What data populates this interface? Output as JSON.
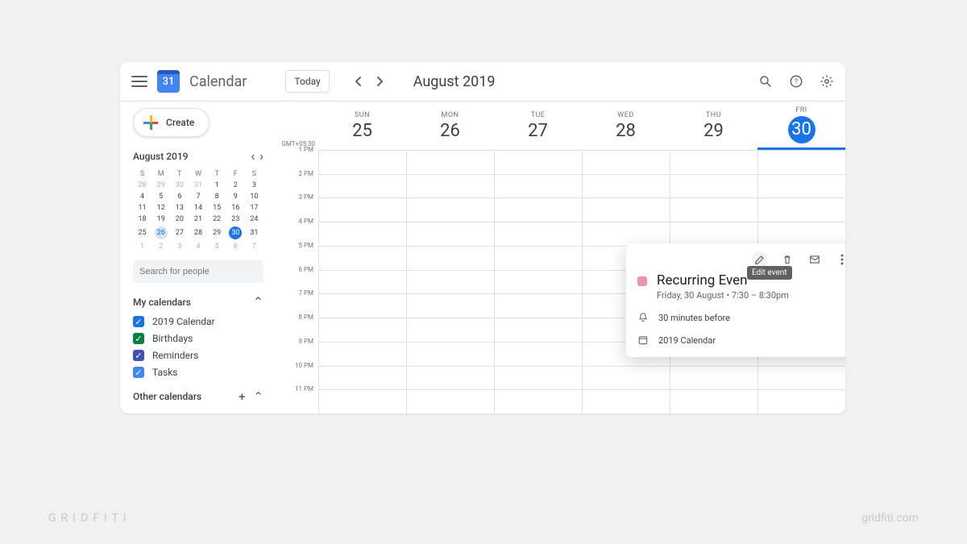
{
  "header": {
    "app_title": "Calendar",
    "logo_day": "31",
    "today_label": "Today",
    "current_range": "August 2019"
  },
  "sidebar": {
    "create_label": "Create",
    "mini": {
      "title": "August 2019",
      "dow": [
        "S",
        "M",
        "T",
        "W",
        "T",
        "F",
        "S"
      ],
      "weeks": [
        [
          {
            "d": "28",
            "dim": true
          },
          {
            "d": "29",
            "dim": true
          },
          {
            "d": "30",
            "dim": true
          },
          {
            "d": "31",
            "dim": true
          },
          {
            "d": "1"
          },
          {
            "d": "2"
          },
          {
            "d": "3"
          }
        ],
        [
          {
            "d": "4"
          },
          {
            "d": "5"
          },
          {
            "d": "6"
          },
          {
            "d": "7"
          },
          {
            "d": "8"
          },
          {
            "d": "9"
          },
          {
            "d": "10"
          }
        ],
        [
          {
            "d": "11"
          },
          {
            "d": "12"
          },
          {
            "d": "13"
          },
          {
            "d": "14"
          },
          {
            "d": "15"
          },
          {
            "d": "16"
          },
          {
            "d": "17"
          }
        ],
        [
          {
            "d": "18"
          },
          {
            "d": "19"
          },
          {
            "d": "20"
          },
          {
            "d": "21"
          },
          {
            "d": "22"
          },
          {
            "d": "23"
          },
          {
            "d": "24"
          }
        ],
        [
          {
            "d": "25"
          },
          {
            "d": "26",
            "sel": true
          },
          {
            "d": "27"
          },
          {
            "d": "28"
          },
          {
            "d": "29"
          },
          {
            "d": "30",
            "today": true
          },
          {
            "d": "31"
          }
        ],
        [
          {
            "d": "1",
            "dim": true
          },
          {
            "d": "2",
            "dim": true
          },
          {
            "d": "3",
            "dim": true
          },
          {
            "d": "4",
            "dim": true
          },
          {
            "d": "5",
            "dim": true
          },
          {
            "d": "6",
            "dim": true
          },
          {
            "d": "7",
            "dim": true
          }
        ]
      ]
    },
    "search_placeholder": "Search for people",
    "my_calendars_label": "My calendars",
    "calendars": [
      {
        "label": "2019 Calendar",
        "color": "#1a73e8"
      },
      {
        "label": "Birthdays",
        "color": "#0b8043"
      },
      {
        "label": "Reminders",
        "color": "#3f51b5"
      },
      {
        "label": "Tasks",
        "color": "#4285f4"
      }
    ],
    "other_calendars_label": "Other calendars"
  },
  "grid": {
    "timezone": "GMT+05:30",
    "days": [
      {
        "dow": "SUN",
        "num": "25"
      },
      {
        "dow": "MON",
        "num": "26"
      },
      {
        "dow": "TUE",
        "num": "27"
      },
      {
        "dow": "WED",
        "num": "28"
      },
      {
        "dow": "THU",
        "num": "29"
      },
      {
        "dow": "FRI",
        "num": "30",
        "today": true
      }
    ],
    "hours": [
      "1 PM",
      "2 PM",
      "3 PM",
      "4 PM",
      "5 PM",
      "6 PM",
      "7 PM",
      "8 PM",
      "9 PM",
      "10 PM",
      "11 PM"
    ]
  },
  "event": {
    "title": "Recurring Event",
    "time": "7:30 – 8:30pm"
  },
  "popover": {
    "tooltip": "Edit event",
    "title": "Recurring Even",
    "subtitle": "Friday, 30 August  •  7:30 – 8:30pm",
    "reminder": "30 minutes before",
    "calendar": "2019 Calendar"
  },
  "watermark": {
    "left": "GRIDFITI",
    "right": "gridfiti.com"
  }
}
